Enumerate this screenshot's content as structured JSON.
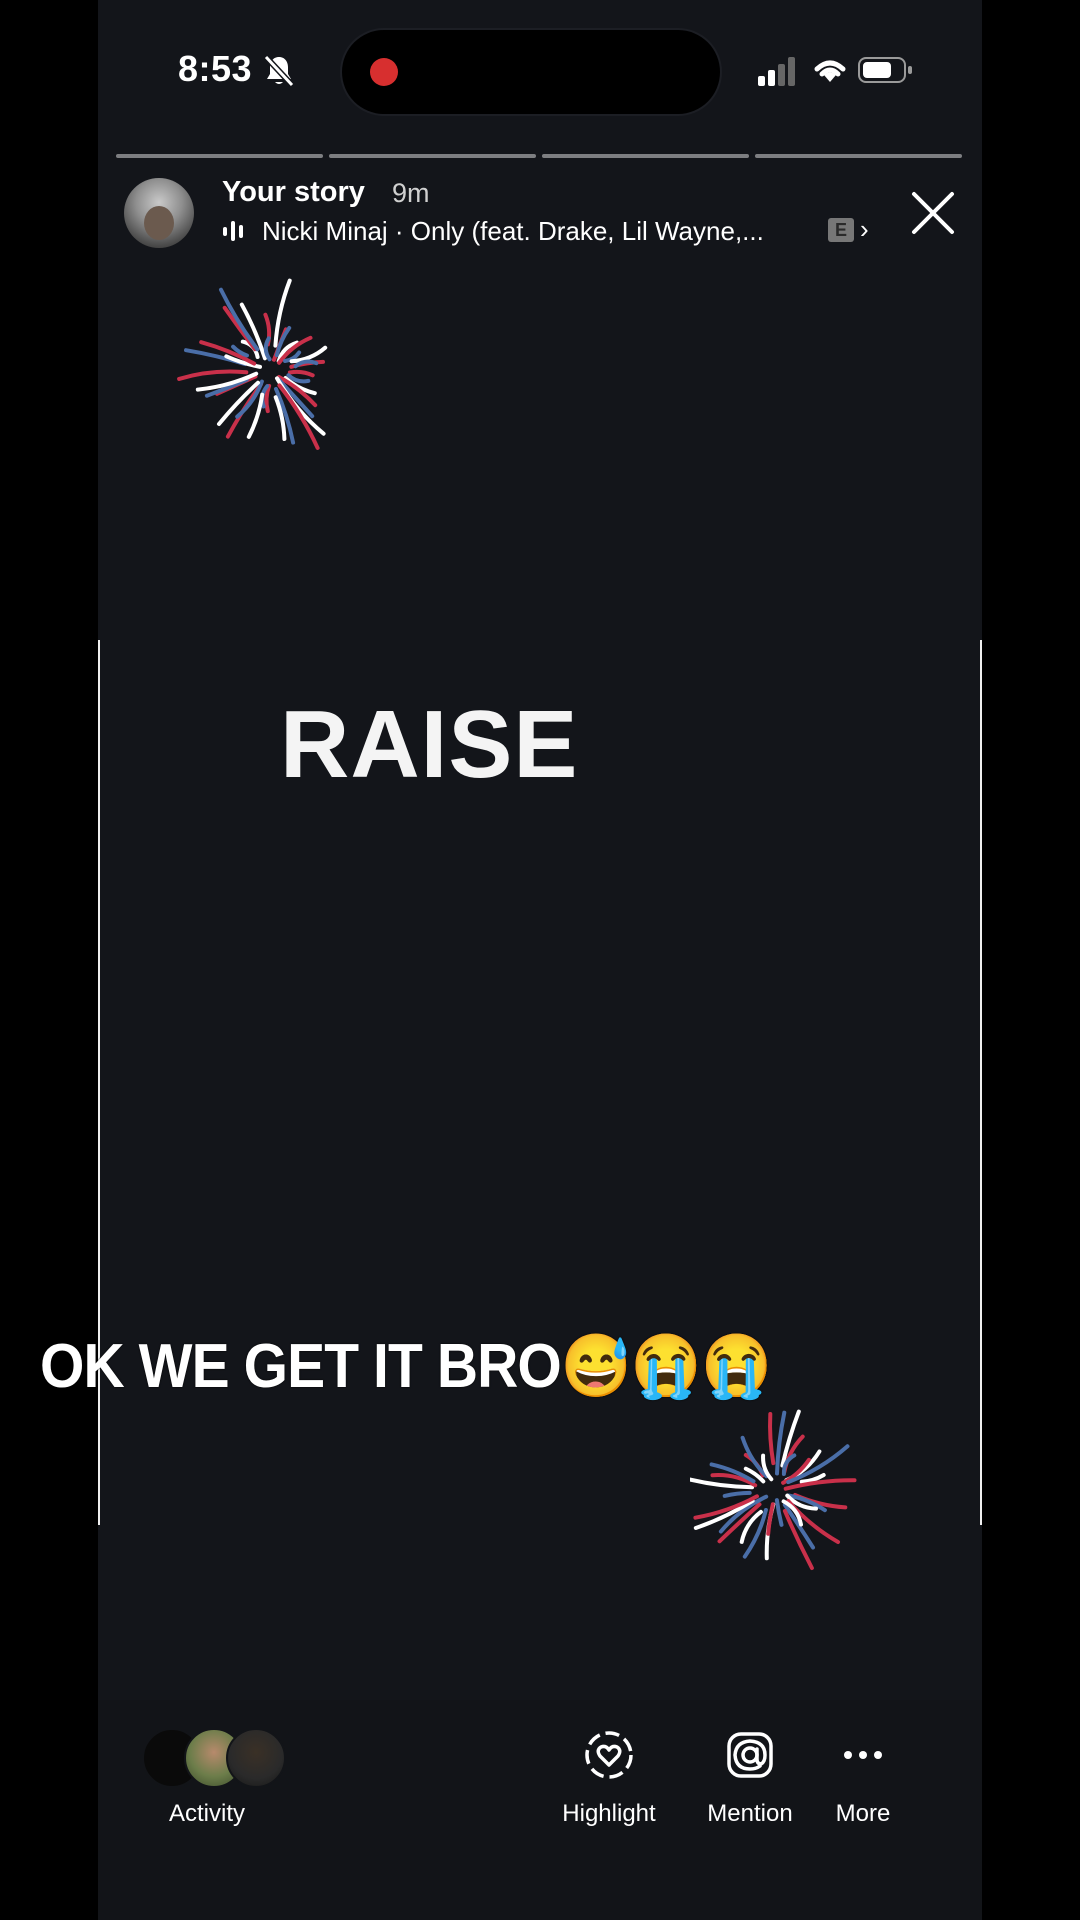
{
  "status_bar": {
    "time": "8:53",
    "icons": [
      "bell-slash-icon",
      "recording-dot-icon",
      "cellular-signal-icon",
      "wifi-icon",
      "battery-icon"
    ]
  },
  "story": {
    "owner_label": "Your story",
    "age": "9m",
    "music": "Nicki Minaj · Only (feat. Drake, Lil Wayne,...",
    "explicit_badge": "E",
    "chevron": "›",
    "segments": 4
  },
  "content": {
    "headline": "RAISE",
    "caption": "OK WE GET IT BRO😅😭😭"
  },
  "bottom_bar": {
    "activity_label": "Activity",
    "highlight_label": "Highlight",
    "mention_label": "Mention",
    "more_label": "More"
  },
  "colors": {
    "background": "#13151a",
    "firework_red": "#c9304a",
    "firework_blue": "#4a6ea8",
    "firework_white": "#ffffff",
    "record": "#d72f2f"
  }
}
